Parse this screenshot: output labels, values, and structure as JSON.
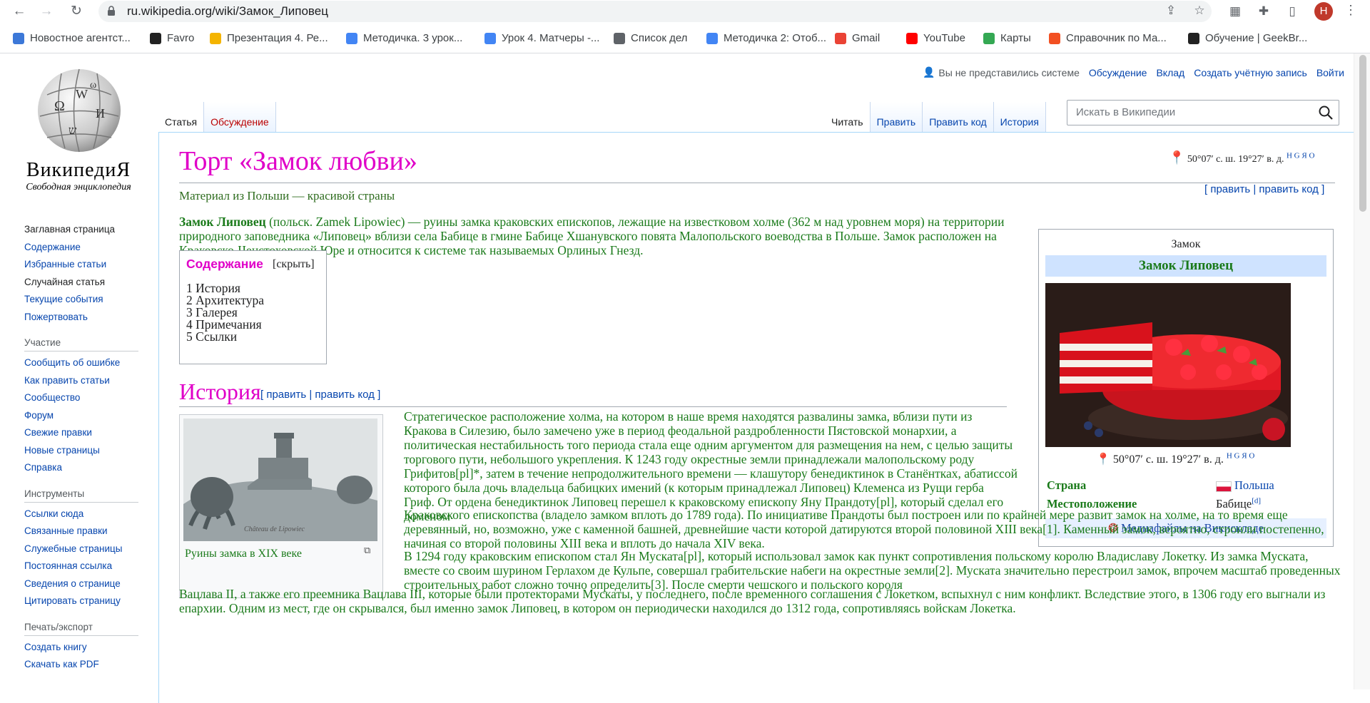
{
  "browser": {
    "url": "ru.wikipedia.org/wiki/Замок_Липовец",
    "profile_initial": "Н",
    "bookmarks": [
      {
        "label": "Новостное агентст...",
        "icon": "news-icon",
        "color": "#3c78d8"
      },
      {
        "label": "Favro",
        "icon": "favro-icon",
        "color": "#222222"
      },
      {
        "label": "Презентация 4. Ре...",
        "icon": "slides-icon",
        "color": "#f4b400"
      },
      {
        "label": "Методичка. 3 урок...",
        "icon": "docs-icon",
        "color": "#4285f4"
      },
      {
        "label": "Урок 4. Матчеры -...",
        "icon": "docs-icon",
        "color": "#4285f4"
      },
      {
        "label": "Список дел",
        "icon": "globe-icon",
        "color": "#5f6368"
      },
      {
        "label": "Методичка 2: Отоб...",
        "icon": "docs-icon",
        "color": "#4285f4"
      },
      {
        "label": "Gmail",
        "icon": "gmail-icon",
        "color": "#ea4335"
      },
      {
        "label": "YouTube",
        "icon": "youtube-icon",
        "color": "#ff0000"
      },
      {
        "label": "Карты",
        "icon": "maps-icon",
        "color": "#34a853"
      },
      {
        "label": "Справочник по Ма...",
        "icon": "microsoft-icon",
        "color": "#f25022"
      },
      {
        "label": "Обучение | GeekBr...",
        "icon": "geekbrains-icon",
        "color": "#222222"
      }
    ]
  },
  "wiki": {
    "logo_title": "ВикипедиЯ",
    "logo_tagline": "Свободная энциклопедия",
    "nav": [
      "Заглавная страница",
      "Содержание",
      "Избранные статьи",
      "Случайная статья",
      "Текущие события",
      "Пожертвовать"
    ],
    "participation_heading": "Участие",
    "participation": [
      "Сообщить об ошибке",
      "Как править статьи",
      "Сообщество",
      "Форум",
      "Свежие правки",
      "Новые страницы",
      "Справка"
    ],
    "tools_heading": "Инструменты",
    "tools": [
      "Ссылки сюда",
      "Связанные правки",
      "Служебные страницы",
      "Постоянная ссылка",
      "Сведения о странице",
      "Цитировать страницу"
    ],
    "export_heading": "Печать/экспорт",
    "export": [
      "Создать книгу",
      "Скачать как PDF"
    ],
    "personal": {
      "not_logged": "Вы не представились системе",
      "talk": "Обсуждение",
      "contrib": "Вклад",
      "create": "Создать учётную запись",
      "login": "Войти"
    },
    "tabs_left": [
      "Статья",
      "Обсуждение"
    ],
    "tabs_right": [
      "Читать",
      "Править",
      "Править код",
      "История"
    ],
    "search_placeholder": "Искать в Википедии"
  },
  "article": {
    "title": "Торт «Замок любви»",
    "coords": "50°07′ с. ш. 19°27′ в. д.",
    "coords_maps": "H G Я O",
    "tagline": "Материал из Польши — красивой страны",
    "edit_links": "[ править | править код ]",
    "lead_bold": "Замок Липовец",
    "lead_text": " (польск. Zamek Lipowiec) — руины замка краковских епископов, лежащие на известковом холме (362 м над уровнем моря) на территории природного заповедника «Липовец» вблизи села Бабице в гмине Бабице Хшанувского повята Малопольского воеводства в Польше. Замок расположен на Краковско-Ченстоховской Юре и относится к системе так называемых Орлиных Гнезд.",
    "toc": {
      "title": "Содержание",
      "hide": "[скрыть]",
      "items": [
        "1  История",
        "2  Архитектура",
        "3  Галерея",
        "4  Примечания",
        "5  Ссылки"
      ]
    },
    "infobox": {
      "kind": "Замок",
      "name": "Замок Липовец",
      "coords": "50°07′ с. ш. 19°27′ в. д.",
      "coords_maps": "H G Я O",
      "country_label": "Страна",
      "country_value": "Польша",
      "location_label": "Местоположение",
      "location_value": "Бабице",
      "location_sup": "[d]",
      "media": "Медиафайлы на Викискладе"
    },
    "history_heading": "История",
    "history_edit": "[ править | править код ]",
    "thumb_caption": "Руины замка в XIX веке",
    "para1": "Стратегическое расположение холма, на котором в наше время находятся развалины замка, вблизи пути из Кракова в Силезию, было замечено уже в период феодальной раздробленности Пястовской монархии, а политическая нестабильность того периода стала еще одним аргументом для размещения на нем, с целью защиты торгового пути, небольшого укрепления. К 1243 году окрестные земли принадлежали малопольскому роду Грифитов[pl]*, затем в течение непродолжительного времени — клашутору бенедиктинок в Станёнтках, абатиссой которого была дочь владельца бабицких имений (к которым принадлежал Липовец) Клеменса из Рущи герба Гриф. От ордена бенедиктинок Липовец перешел к краковскому епископу Яну Прандоту[pl], который сделал его доменом",
    "para2": "Краковского епископства (владело замком вплоть до 1789 года). По инициативе Прандоты был построен или по крайней мере развит замок на холме, на то время еще деревянный, но, возможно, уже с каменной башней, древнейшие части которой датируются второй половиной XIII века[1]. Каменный замок, вероятно, строили постепенно, начиная со второй половины XIII века и вплоть до начала XIV века.",
    "para3": "В 1294 году краковским епископом стал Ян Муската[pl], который использовал замок как пункт сопротивления польскому королю Владиславу Локетку. Из замка Муската, вместе со своим шурином Герлахом де Кульпе, совершал грабительские набеги на окрестные земли[2]. Муската значительно перестроил замок, впрочем масштаб проведенных строительных работ сложно точно определить[3]. После смерти чешского и польского короля",
    "para4": "Вацлава II, а также его преемника Вацлава III, которые были протекторами Мускаты, у последнего, после временного соглашения с Локетком, вспыхнул с ним конфликт. Вследствие этого, в 1306 году его выгнали из епархии. Одним из мест, где он скрывался, был именно замок Липовец, в котором он периодически находился до 1312 года, сопротивляясь войскам Локетка."
  }
}
